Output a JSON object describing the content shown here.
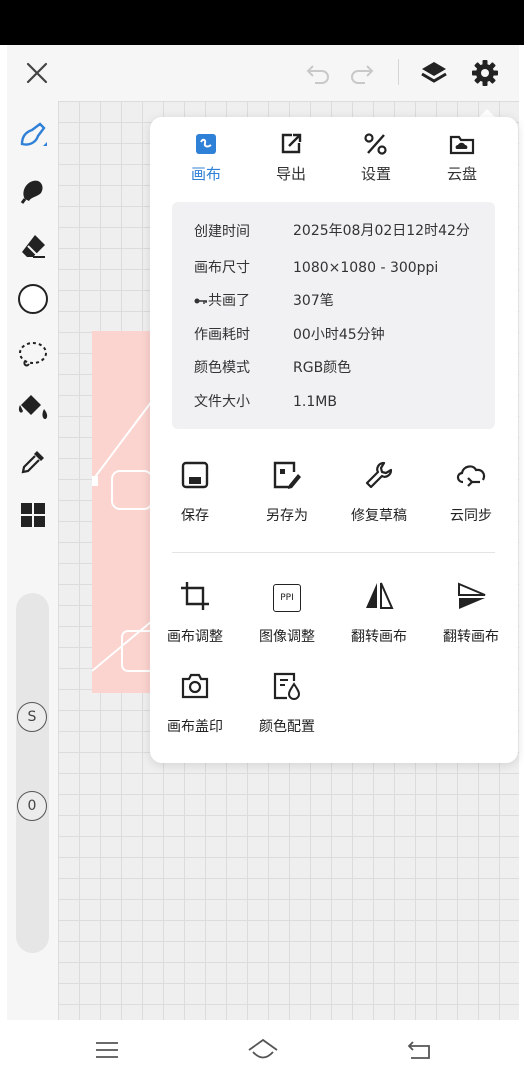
{
  "app": {
    "toolbar_icons": [
      "close-icon",
      "undo-icon",
      "redo-icon",
      "layers-icon",
      "gear-icon"
    ]
  },
  "left_tools": [
    "brush-icon",
    "smudge-icon",
    "eraser-icon",
    "circle-shape-icon",
    "lasso-icon",
    "fill-bucket-icon",
    "eyedropper-icon",
    "grid-icon"
  ],
  "slider": {
    "size_badge": "S",
    "opacity_badge": "0"
  },
  "panel": {
    "tabs": [
      {
        "label": "画布",
        "icon": "canvas-icon",
        "active": true
      },
      {
        "label": "导出",
        "icon": "export-icon",
        "active": false
      },
      {
        "label": "设置",
        "icon": "settings-icon",
        "active": false
      },
      {
        "label": "云盘",
        "icon": "cloud-drive-icon",
        "active": false
      }
    ],
    "info": [
      {
        "label": "创建时间",
        "value": "2025年08月02日12时42分"
      },
      {
        "label": "画布尺寸",
        "value": "1080×1080 - 300ppi"
      },
      {
        "label": "共画了",
        "value": "307笔"
      },
      {
        "label": "作画耗时",
        "value": "00小时45分钟"
      },
      {
        "label": "颜色模式",
        "value": "RGB颜色"
      },
      {
        "label": "文件大小",
        "value": "1.1MB"
      }
    ],
    "actions_row1": [
      {
        "label": "保存",
        "icon": "save-icon"
      },
      {
        "label": "另存为",
        "icon": "save-as-icon"
      },
      {
        "label": "修复草稿",
        "icon": "repair-icon"
      },
      {
        "label": "云同步",
        "icon": "cloud-sync-icon"
      }
    ],
    "actions_row2": [
      {
        "label": "画布调整",
        "icon": "crop-icon"
      },
      {
        "label": "图像调整",
        "icon": "ppi-icon",
        "icon_text": "PPI"
      },
      {
        "label": "翻转画布",
        "icon": "flip-horizontal-icon"
      },
      {
        "label": "翻转画布",
        "icon": "flip-vertical-icon"
      }
    ],
    "actions_row3": [
      {
        "label": "画布盖印",
        "icon": "camera-stamp-icon"
      },
      {
        "label": "颜色配置",
        "icon": "color-config-icon"
      }
    ]
  },
  "colors": {
    "accent": "#2f80d7",
    "artwork": "#fbd3cf"
  },
  "nav_icons": [
    "menu-icon",
    "home-icon",
    "back-icon"
  ]
}
